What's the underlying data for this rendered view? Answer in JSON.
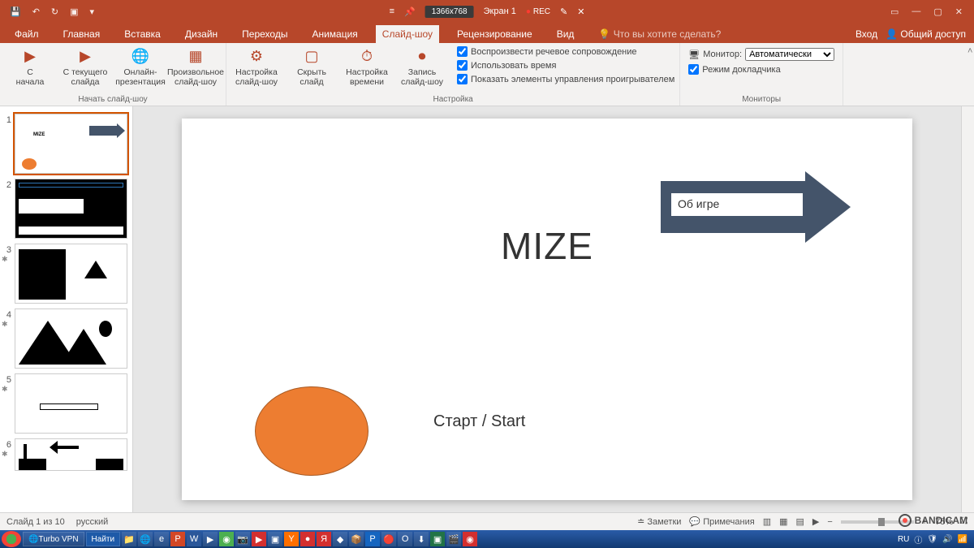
{
  "titlebar": {
    "resolution": "1366x768",
    "screen": "Экран 1",
    "rec": "REC"
  },
  "tabs": {
    "file": "Файл",
    "home": "Главная",
    "insert": "Вставка",
    "design": "Дизайн",
    "transitions": "Переходы",
    "animation": "Анимация",
    "slideshow": "Слайд-шоу",
    "review": "Рецензирование",
    "view": "Вид",
    "tell": "Что вы хотите сделать?",
    "login": "Вход",
    "share": "Общий доступ"
  },
  "ribbon": {
    "fromStart": "С\nначала",
    "fromCurrent": "С текущего\nслайда",
    "online": "Онлайн-\nпрезентация",
    "custom": "Произвольное\nслайд-шоу",
    "g1": "Начать слайд-шоу",
    "setup": "Настройка\nслайд-шоу",
    "hide": "Скрыть\nслайд",
    "rehearse": "Настройка\nвремени",
    "record": "Запись\nслайд-шоу",
    "chk1": "Воспроизвести речевое сопровождение",
    "chk2": "Использовать время",
    "chk3": "Показать элементы управления проигрывателем",
    "g2": "Настройка",
    "monitor": "Монитор:",
    "monVal": "Автоматически",
    "presenter": "Режим докладчика",
    "g3": "Мониторы"
  },
  "slide": {
    "title": "MIZE",
    "arrowText": "Об игре",
    "startText": "Старт / Start"
  },
  "thumbs": [
    "1",
    "2",
    "3",
    "4",
    "5",
    "6"
  ],
  "status": {
    "slideOf": "Слайд 1 из 10",
    "lang": "русский",
    "notes": "Заметки",
    "comments": "Примечания",
    "zoom": "75%"
  },
  "taskbar": {
    "app1": "Turbo VPN",
    "find": "Найти",
    "lang": "RU"
  },
  "watermark": "BANDICAM"
}
